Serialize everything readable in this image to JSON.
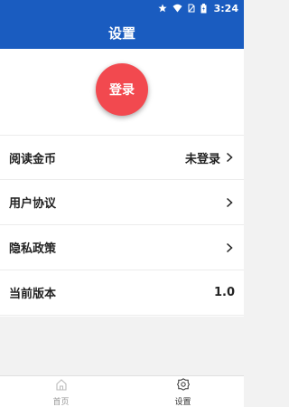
{
  "status_bar": {
    "time": "3:24"
  },
  "header": {
    "title": "设置"
  },
  "login_button": {
    "label": "登录"
  },
  "settings": [
    {
      "label": "阅读金币",
      "value": "未登录",
      "chevron": true
    },
    {
      "label": "用户协议",
      "value": "",
      "chevron": true
    },
    {
      "label": "隐私政策",
      "value": "",
      "chevron": true
    },
    {
      "label": "当前版本",
      "value": "1.0",
      "chevron": false
    }
  ],
  "tabs": [
    {
      "label": "首页",
      "icon": "home-icon",
      "active": false
    },
    {
      "label": "设置",
      "icon": "settings-gear-icon",
      "active": true
    }
  ],
  "colors": {
    "brand": "#1a5cc0",
    "login": "#f2494f",
    "background": "#f2f2f2"
  }
}
